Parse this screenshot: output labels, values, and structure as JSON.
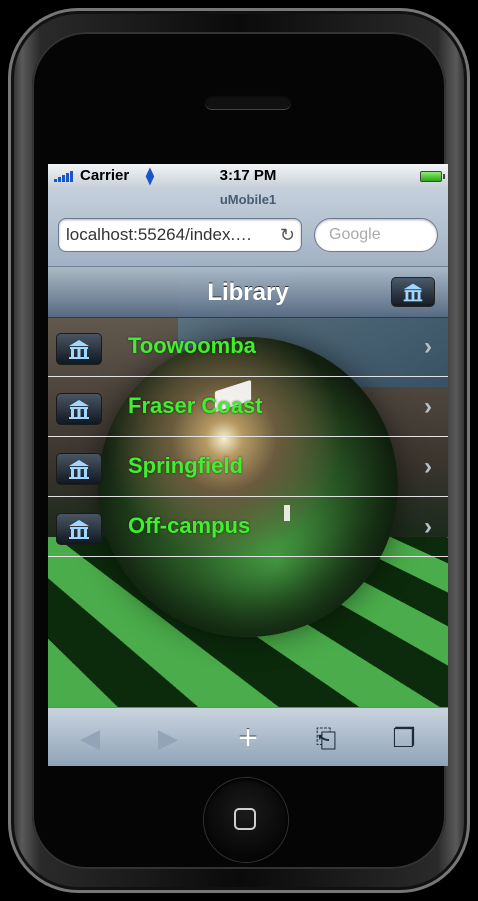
{
  "status_bar": {
    "carrier": "Carrier",
    "time": "3:17 PM"
  },
  "browser": {
    "page_title": "uMobile1",
    "url": "localhost:55264/index.…",
    "search_placeholder": "Google"
  },
  "navbar": {
    "title": "Library",
    "button_icon": "museum-icon"
  },
  "list": {
    "items": [
      {
        "label": "Toowoomba",
        "icon": "museum-icon"
      },
      {
        "label": "Fraser Coast",
        "icon": "museum-icon"
      },
      {
        "label": "Springfield",
        "icon": "museum-icon"
      },
      {
        "label": "Off-campus",
        "icon": "museum-icon"
      }
    ],
    "label_color": "#3ff02f"
  },
  "toolbar": {
    "back": "◀",
    "forward": "▶",
    "add": "+",
    "bookmarks": "⎗",
    "pages": "❐"
  },
  "colors": {
    "accent_blue": "#1a56c8",
    "nav_gradient_top": "#afbdcc",
    "nav_gradient_bottom": "#586c84"
  }
}
